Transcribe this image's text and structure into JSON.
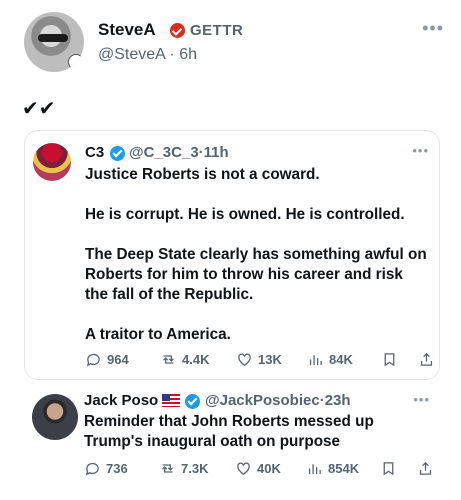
{
  "main_post": {
    "name": "SteveA",
    "platform_label": "GETTR",
    "handle": "@SteveA",
    "separator": "·",
    "time": "6h",
    "text": "✔✔"
  },
  "quoted_post": {
    "name": "C3",
    "handle": "@C_3C_3",
    "time": "11h",
    "paragraphs": [
      "Justice Roberts is not a coward.",
      "He is corrupt. He is owned. He is controlled.",
      "The Deep State clearly has something awful on Roberts for him to throw his career and risk the fall of the Republic.",
      "A traitor to America."
    ],
    "actions": {
      "replies": "964",
      "reposts": "4.4K",
      "likes": "13K",
      "views": "84K"
    }
  },
  "reply_post": {
    "name": "Jack Poso",
    "handle": "@JackPosobiec",
    "time": "23h",
    "text": "Reminder that John Roberts messed up Trump's inaugural oath on purpose",
    "actions": {
      "replies": "736",
      "reposts": "7.3K",
      "likes": "40K",
      "views": "854K"
    }
  },
  "colors": {
    "verified": "#1d9bf0",
    "gettr": "#e0281b",
    "muted": "#536471"
  },
  "icons": [
    "gettr-check-icon",
    "verified-icon",
    "reply-icon",
    "repost-icon",
    "like-icon",
    "views-icon",
    "bookmark-icon",
    "share-icon",
    "more-icon",
    "us-flag-icon"
  ]
}
